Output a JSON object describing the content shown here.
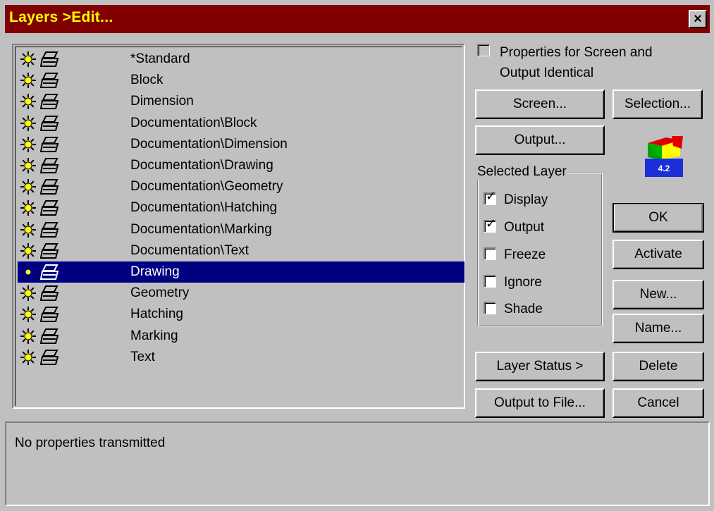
{
  "window": {
    "title": "Layers >Edit...",
    "close_glyph": "×"
  },
  "layers": [
    {
      "name": "*Standard",
      "visible": true,
      "selected": false
    },
    {
      "name": "Block",
      "visible": true,
      "selected": false
    },
    {
      "name": "Dimension",
      "visible": true,
      "selected": false
    },
    {
      "name": "Documentation\\Block",
      "visible": true,
      "selected": false
    },
    {
      "name": "Documentation\\Dimension",
      "visible": true,
      "selected": false
    },
    {
      "name": "Documentation\\Drawing",
      "visible": true,
      "selected": false
    },
    {
      "name": "Documentation\\Geometry",
      "visible": true,
      "selected": false
    },
    {
      "name": "Documentation\\Hatching",
      "visible": true,
      "selected": false
    },
    {
      "name": "Documentation\\Marking",
      "visible": true,
      "selected": false
    },
    {
      "name": "Documentation\\Text",
      "visible": true,
      "selected": false
    },
    {
      "name": "Drawing",
      "visible": true,
      "selected": true
    },
    {
      "name": "Geometry",
      "visible": true,
      "selected": false
    },
    {
      "name": "Hatching",
      "visible": true,
      "selected": false
    },
    {
      "name": "Marking",
      "visible": true,
      "selected": false
    },
    {
      "name": "Text",
      "visible": true,
      "selected": false
    }
  ],
  "properties": {
    "label_line1": "Properties for Screen and",
    "label_line2": "Output Identical",
    "checked": false
  },
  "buttons": {
    "screen": "Screen...",
    "selection": "Selection...",
    "output": "Output...",
    "ok": "OK",
    "activate": "Activate",
    "new": "New...",
    "name": "Name...",
    "layer_status": "Layer Status >",
    "delete": "Delete",
    "output_to_file": "Output to File...",
    "cancel": "Cancel"
  },
  "selected_layer": {
    "label": "Selected Layer",
    "display": {
      "label": "Display",
      "checked": true
    },
    "output": {
      "label": "Output",
      "checked": true
    },
    "freeze": {
      "label": "Freeze",
      "checked": false
    },
    "ignore": {
      "label": "Ignore",
      "checked": false
    },
    "shade": {
      "label": "Shade",
      "checked": false
    }
  },
  "logo": {
    "version": "4.2"
  },
  "status": {
    "text": "No properties transmitted"
  },
  "colors": {
    "title_bar": "#800000",
    "title_text": "#ffff00",
    "selection": "#000080",
    "sun": "#ffff00"
  }
}
